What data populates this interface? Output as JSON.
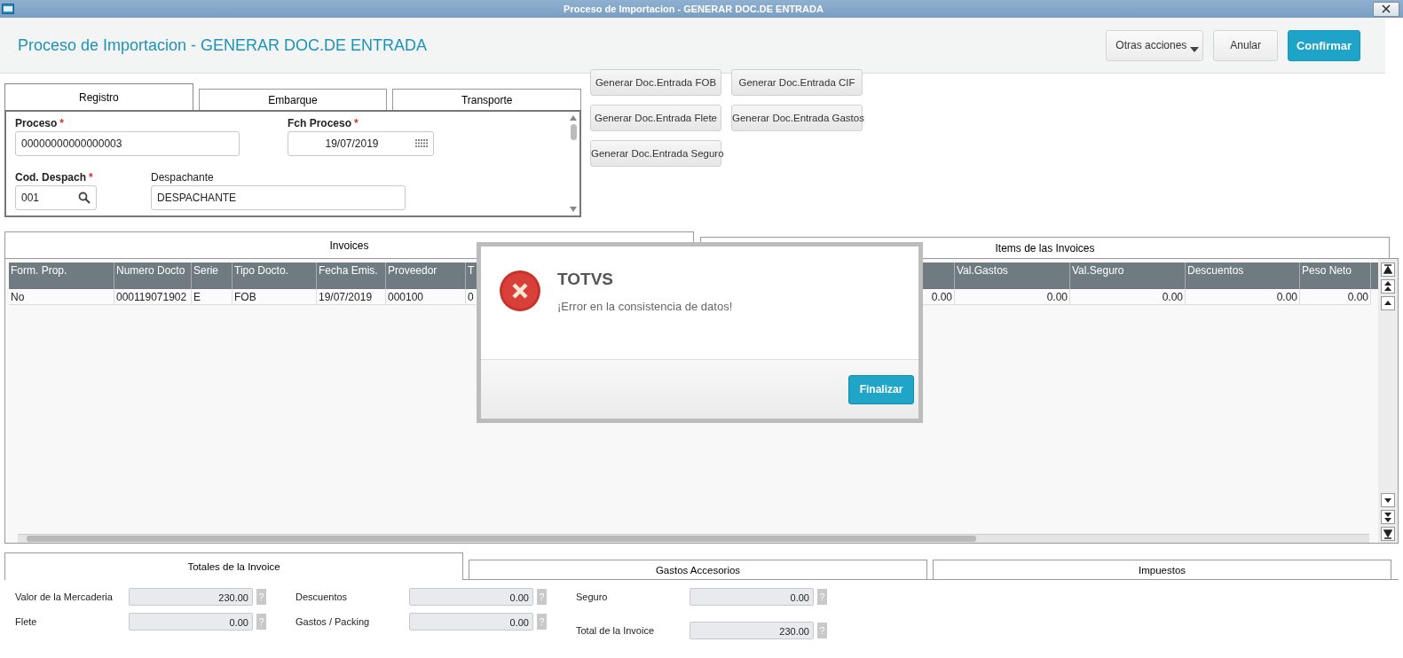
{
  "window": {
    "title": "Proceso de Importacion - GENERAR DOC.DE ENTRADA"
  },
  "header": {
    "title": "Proceso de Importacion - GENERAR DOC.DE ENTRADA",
    "actions": [
      {
        "label": "Otras acciones",
        "kind": "dropdown"
      },
      {
        "label": "Anular",
        "kind": "secondary"
      },
      {
        "label": "Confirmar",
        "kind": "primary"
      }
    ]
  },
  "form_tabs": [
    {
      "label": "Registro",
      "selected": true
    },
    {
      "label": "Embarque",
      "selected": false
    },
    {
      "label": "Transporte",
      "selected": false
    }
  ],
  "form_fields": [
    {
      "label": "Proceso",
      "required_mark": "*",
      "value": "00000000000000003",
      "kind": "text"
    },
    {
      "label": "Fch Proceso",
      "required_mark": "*",
      "value": "19/07/2019",
      "kind": "date"
    },
    {
      "label": "Cod. Despach",
      "required_mark": "*",
      "value": "001",
      "kind": "lookup"
    },
    {
      "label": "Despachante",
      "value": "DESPACHANTE",
      "kind": "text"
    }
  ],
  "generate_buttons": [
    "Generar Doc.Entrada FOB",
    "Generar Doc.Entrada CIF",
    "Generar Doc.Entrada Flete",
    "Generar Doc.Entrada Gastos",
    "Generar Doc.Entrada Seguro"
  ],
  "grid_tabs": [
    {
      "label": "Invoices",
      "selected": true
    },
    {
      "label": "Items de las Invoices",
      "selected": false
    }
  ],
  "grid": {
    "columns": [
      "Form. Prop.",
      "Numero Docto",
      "Serie",
      "Tipo Docto.",
      "Fecha Emis.",
      "Proveedor",
      "T",
      null,
      "Val.Gastos",
      "Val.Seguro",
      "Descuentos",
      "Peso Neto"
    ],
    "rows": [
      [
        "No",
        "000119071902",
        "E",
        "FOB",
        "19/07/2019",
        "000100",
        "0",
        "0.00",
        "0.00",
        "0.00",
        "0.00",
        "0.00"
      ]
    ]
  },
  "bottom_tabs": [
    {
      "label": "Totales de la Invoice",
      "selected": true
    },
    {
      "label": "Gastos Accesorios",
      "selected": false
    },
    {
      "label": "Impuestos",
      "selected": false
    }
  ],
  "totals": [
    {
      "fields": [
        {
          "label": "Valor de la Mercaderia",
          "value": "230.00",
          "help": "?"
        },
        {
          "label": "Flete",
          "value": "0.00",
          "help": "?"
        }
      ]
    },
    {
      "fields": [
        {
          "label": "Descuentos",
          "value": "0.00",
          "help": "?"
        },
        {
          "label": "Gastos / Packing",
          "value": "0.00",
          "help": "?"
        }
      ]
    },
    {
      "fields": [
        {
          "label": "Seguro",
          "value": "0.00",
          "help": "?"
        },
        {
          "label": "Total de la Invoice",
          "value": "230.00",
          "help": "?"
        }
      ]
    }
  ],
  "dialog": {
    "title": "TOTVS",
    "message": "¡Error en la consistencia de datos!",
    "button": "Finalizar"
  }
}
